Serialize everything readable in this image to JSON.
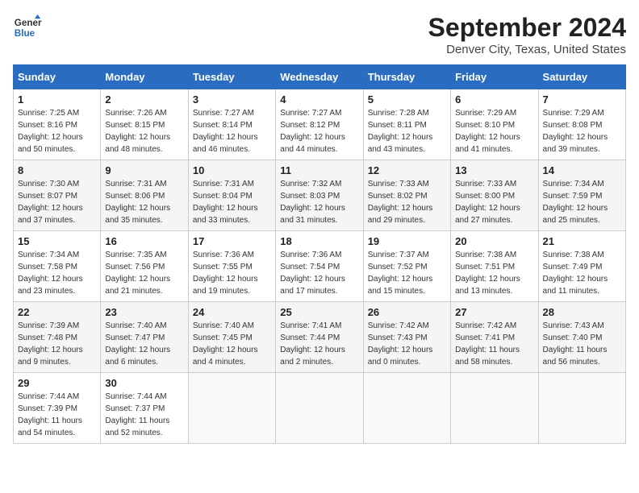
{
  "header": {
    "logo_line1": "General",
    "logo_line2": "Blue",
    "title": "September 2024",
    "subtitle": "Denver City, Texas, United States"
  },
  "calendar": {
    "days_of_week": [
      "Sunday",
      "Monday",
      "Tuesday",
      "Wednesday",
      "Thursday",
      "Friday",
      "Saturday"
    ],
    "weeks": [
      [
        {
          "day": "",
          "info": ""
        },
        {
          "day": "2",
          "info": "Sunrise: 7:26 AM\nSunset: 8:15 PM\nDaylight: 12 hours\nand 48 minutes."
        },
        {
          "day": "3",
          "info": "Sunrise: 7:27 AM\nSunset: 8:14 PM\nDaylight: 12 hours\nand 46 minutes."
        },
        {
          "day": "4",
          "info": "Sunrise: 7:27 AM\nSunset: 8:12 PM\nDaylight: 12 hours\nand 44 minutes."
        },
        {
          "day": "5",
          "info": "Sunrise: 7:28 AM\nSunset: 8:11 PM\nDaylight: 12 hours\nand 43 minutes."
        },
        {
          "day": "6",
          "info": "Sunrise: 7:29 AM\nSunset: 8:10 PM\nDaylight: 12 hours\nand 41 minutes."
        },
        {
          "day": "7",
          "info": "Sunrise: 7:29 AM\nSunset: 8:08 PM\nDaylight: 12 hours\nand 39 minutes."
        }
      ],
      [
        {
          "day": "1",
          "info": "Sunrise: 7:25 AM\nSunset: 8:16 PM\nDaylight: 12 hours\nand 50 minutes."
        },
        {
          "day": "",
          "info": ""
        },
        {
          "day": "",
          "info": ""
        },
        {
          "day": "",
          "info": ""
        },
        {
          "day": "",
          "info": ""
        },
        {
          "day": "",
          "info": ""
        },
        {
          "day": "",
          "info": ""
        }
      ],
      [
        {
          "day": "8",
          "info": "Sunrise: 7:30 AM\nSunset: 8:07 PM\nDaylight: 12 hours\nand 37 minutes."
        },
        {
          "day": "9",
          "info": "Sunrise: 7:31 AM\nSunset: 8:06 PM\nDaylight: 12 hours\nand 35 minutes."
        },
        {
          "day": "10",
          "info": "Sunrise: 7:31 AM\nSunset: 8:04 PM\nDaylight: 12 hours\nand 33 minutes."
        },
        {
          "day": "11",
          "info": "Sunrise: 7:32 AM\nSunset: 8:03 PM\nDaylight: 12 hours\nand 31 minutes."
        },
        {
          "day": "12",
          "info": "Sunrise: 7:33 AM\nSunset: 8:02 PM\nDaylight: 12 hours\nand 29 minutes."
        },
        {
          "day": "13",
          "info": "Sunrise: 7:33 AM\nSunset: 8:00 PM\nDaylight: 12 hours\nand 27 minutes."
        },
        {
          "day": "14",
          "info": "Sunrise: 7:34 AM\nSunset: 7:59 PM\nDaylight: 12 hours\nand 25 minutes."
        }
      ],
      [
        {
          "day": "15",
          "info": "Sunrise: 7:34 AM\nSunset: 7:58 PM\nDaylight: 12 hours\nand 23 minutes."
        },
        {
          "day": "16",
          "info": "Sunrise: 7:35 AM\nSunset: 7:56 PM\nDaylight: 12 hours\nand 21 minutes."
        },
        {
          "day": "17",
          "info": "Sunrise: 7:36 AM\nSunset: 7:55 PM\nDaylight: 12 hours\nand 19 minutes."
        },
        {
          "day": "18",
          "info": "Sunrise: 7:36 AM\nSunset: 7:54 PM\nDaylight: 12 hours\nand 17 minutes."
        },
        {
          "day": "19",
          "info": "Sunrise: 7:37 AM\nSunset: 7:52 PM\nDaylight: 12 hours\nand 15 minutes."
        },
        {
          "day": "20",
          "info": "Sunrise: 7:38 AM\nSunset: 7:51 PM\nDaylight: 12 hours\nand 13 minutes."
        },
        {
          "day": "21",
          "info": "Sunrise: 7:38 AM\nSunset: 7:49 PM\nDaylight: 12 hours\nand 11 minutes."
        }
      ],
      [
        {
          "day": "22",
          "info": "Sunrise: 7:39 AM\nSunset: 7:48 PM\nDaylight: 12 hours\nand 9 minutes."
        },
        {
          "day": "23",
          "info": "Sunrise: 7:40 AM\nSunset: 7:47 PM\nDaylight: 12 hours\nand 6 minutes."
        },
        {
          "day": "24",
          "info": "Sunrise: 7:40 AM\nSunset: 7:45 PM\nDaylight: 12 hours\nand 4 minutes."
        },
        {
          "day": "25",
          "info": "Sunrise: 7:41 AM\nSunset: 7:44 PM\nDaylight: 12 hours\nand 2 minutes."
        },
        {
          "day": "26",
          "info": "Sunrise: 7:42 AM\nSunset: 7:43 PM\nDaylight: 12 hours\nand 0 minutes."
        },
        {
          "day": "27",
          "info": "Sunrise: 7:42 AM\nSunset: 7:41 PM\nDaylight: 11 hours\nand 58 minutes."
        },
        {
          "day": "28",
          "info": "Sunrise: 7:43 AM\nSunset: 7:40 PM\nDaylight: 11 hours\nand 56 minutes."
        }
      ],
      [
        {
          "day": "29",
          "info": "Sunrise: 7:44 AM\nSunset: 7:39 PM\nDaylight: 11 hours\nand 54 minutes."
        },
        {
          "day": "30",
          "info": "Sunrise: 7:44 AM\nSunset: 7:37 PM\nDaylight: 11 hours\nand 52 minutes."
        },
        {
          "day": "",
          "info": ""
        },
        {
          "day": "",
          "info": ""
        },
        {
          "day": "",
          "info": ""
        },
        {
          "day": "",
          "info": ""
        },
        {
          "day": "",
          "info": ""
        }
      ]
    ]
  }
}
